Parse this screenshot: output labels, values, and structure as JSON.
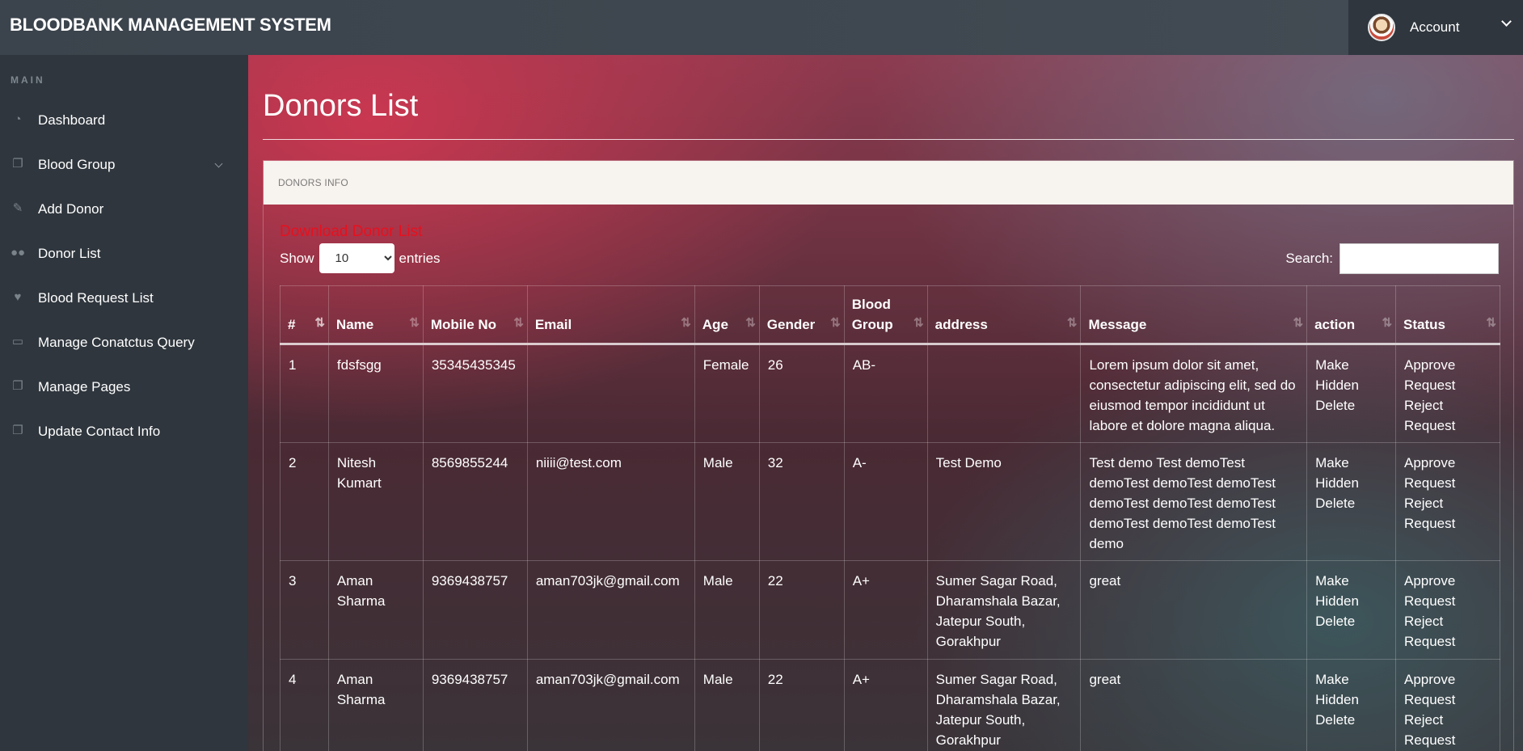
{
  "header": {
    "brand": "BLOODBANK MANAGEMENT SYSTEM",
    "account_label": "Account"
  },
  "sidebar": {
    "section_title": "MAIN",
    "items": [
      {
        "label": "Dashboard",
        "icon": "dashboard-icon"
      },
      {
        "label": "Blood Group",
        "icon": "copy-icon",
        "has_submenu": true
      },
      {
        "label": "Add Donor",
        "icon": "edit-icon"
      },
      {
        "label": "Donor List",
        "icon": "users-icon"
      },
      {
        "label": "Blood Request List",
        "icon": "heartbeat-icon"
      },
      {
        "label": "Manage Conatctus Query",
        "icon": "desktop-icon"
      },
      {
        "label": "Manage Pages",
        "icon": "copy-icon"
      },
      {
        "label": "Update Contact Info",
        "icon": "copy-icon"
      }
    ]
  },
  "main": {
    "title": "Donors List",
    "panel_heading": "DONORS INFO",
    "download_link": "Download Donor List",
    "show_label": "Show",
    "entries_value": "10",
    "entries_label": "entries",
    "search_label": "Search:",
    "search_value": ""
  },
  "table": {
    "columns": [
      "#",
      "Name",
      "Mobile No",
      "Email",
      "Age",
      "Gender",
      "Blood Group",
      "address",
      "Message",
      "action",
      "Status"
    ],
    "rows": [
      {
        "num": "1",
        "name": "fdsfsgg",
        "mobile": "35345435345",
        "email": "",
        "age": "Female",
        "gender": "26",
        "blood": "AB-",
        "address": "",
        "message": "Lorem ipsum dolor sit amet, consectetur adipiscing elit, sed do eiusmod tempor incididunt ut labore et dolore magna aliqua.",
        "action1": "Make Hidden",
        "action2": "Delete",
        "status1": "Approve Request",
        "status2": "Reject Request"
      },
      {
        "num": "2",
        "name": "Nitesh Kumart",
        "mobile": "8569855244",
        "email": "niiii@test.com",
        "age": "Male",
        "gender": "32",
        "blood": "A-",
        "address": "Test Demo",
        "message": "Test demo Test demoTest demoTest demoTest demoTest demoTest demoTest demoTest demoTest demoTest demoTest demo",
        "action1": "Make Hidden",
        "action2": "Delete",
        "status1": "Approve Request",
        "status2": "Reject Request"
      },
      {
        "num": "3",
        "name": "Aman Sharma",
        "mobile": "9369438757",
        "email": "aman703jk@gmail.com",
        "age": "Male",
        "gender": "22",
        "blood": "A+",
        "address": "Sumer Sagar Road, Dharamshala Bazar, Jatepur South, Gorakhpur",
        "message": "great",
        "action1": "Make Hidden",
        "action2": "Delete",
        "status1": "Approve Request",
        "status2": "Reject Request"
      },
      {
        "num": "4",
        "name": "Aman Sharma",
        "mobile": "9369438757",
        "email": "aman703jk@gmail.com",
        "age": "Male",
        "gender": "22",
        "blood": "A+",
        "address": "Sumer Sagar Road, Dharamshala Bazar, Jatepur South, Gorakhpur",
        "message": "great",
        "action1": "Make Hidden",
        "action2": "Delete",
        "status1": "Approve Request",
        "status2": "Reject Request"
      }
    ]
  }
}
